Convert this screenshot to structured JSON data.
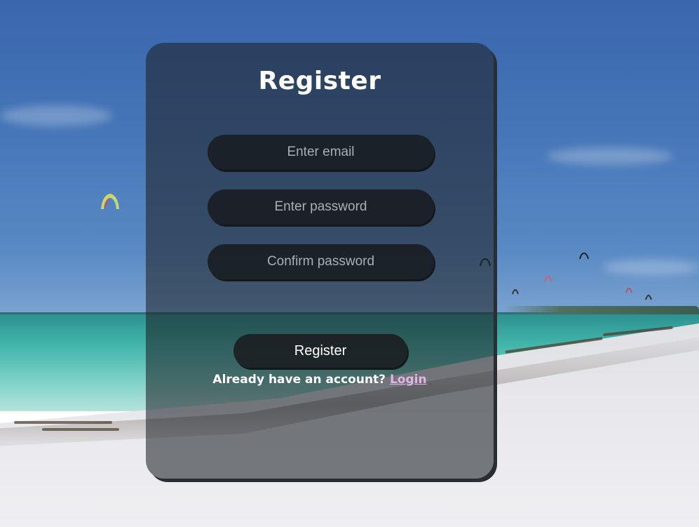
{
  "form": {
    "title": "Register",
    "email_placeholder": "Enter email",
    "password_placeholder": "Enter password",
    "confirm_placeholder": "Confirm password",
    "submit_label": "Register",
    "footer_text": "Already have an account?",
    "login_link": "Login"
  },
  "colors": {
    "card_background": "#1e2228",
    "link": "#e3b4e6",
    "text": "#ffffff"
  }
}
